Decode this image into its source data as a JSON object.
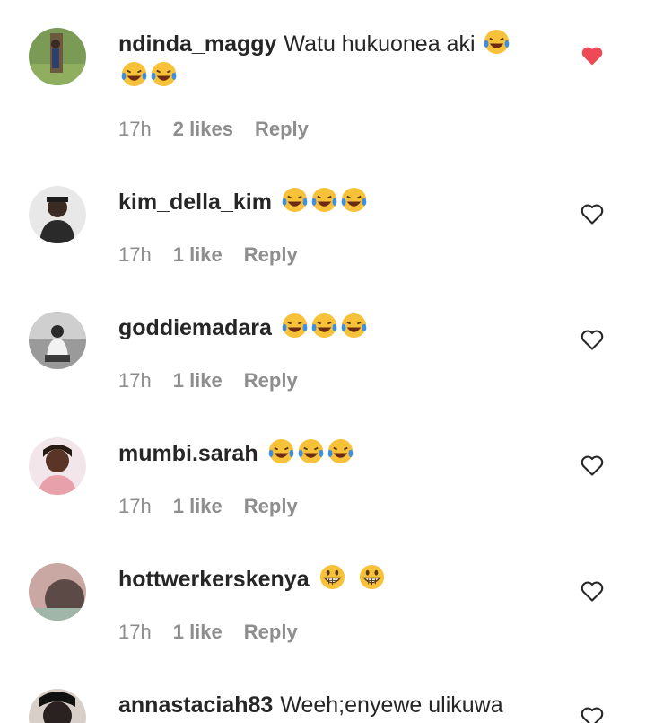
{
  "comments": [
    {
      "username": "ndinda_maggy",
      "text": "Watu hukuonea aki",
      "emojis": [
        "laughing-crying",
        "laughing-crying",
        "laughing-crying"
      ],
      "time": "17h",
      "likes": "2 likes",
      "reply": "Reply",
      "liked": true
    },
    {
      "username": "kim_della_kim",
      "text": "",
      "emojis": [
        "laughing-crying",
        "laughing-crying",
        "laughing-crying"
      ],
      "time": "17h",
      "likes": "1 like",
      "reply": "Reply",
      "liked": false
    },
    {
      "username": "goddiemadara",
      "text": "",
      "emojis": [
        "laughing-crying",
        "laughing-crying",
        "laughing-crying"
      ],
      "time": "17h",
      "likes": "1 like",
      "reply": "Reply",
      "liked": false
    },
    {
      "username": "mumbi.sarah",
      "text": "",
      "emojis": [
        "laughing-crying",
        "laughing-crying",
        "laughing-crying"
      ],
      "time": "17h",
      "likes": "1 like",
      "reply": "Reply",
      "liked": false
    },
    {
      "username": "hottwerkerskenya",
      "text": "",
      "emojis": [
        "grinning",
        "grinning"
      ],
      "time": "17h",
      "likes": "1 like",
      "reply": "Reply",
      "liked": false
    },
    {
      "username": "annastaciah83",
      "text": "Weeh;enyewe ulikuwa",
      "emojis": [],
      "time": "",
      "likes": "",
      "reply": "",
      "liked": false
    }
  ],
  "colors": {
    "liked_heart": "#ed4956",
    "outline_heart": "#262626",
    "meta": "#8e8e8e"
  }
}
